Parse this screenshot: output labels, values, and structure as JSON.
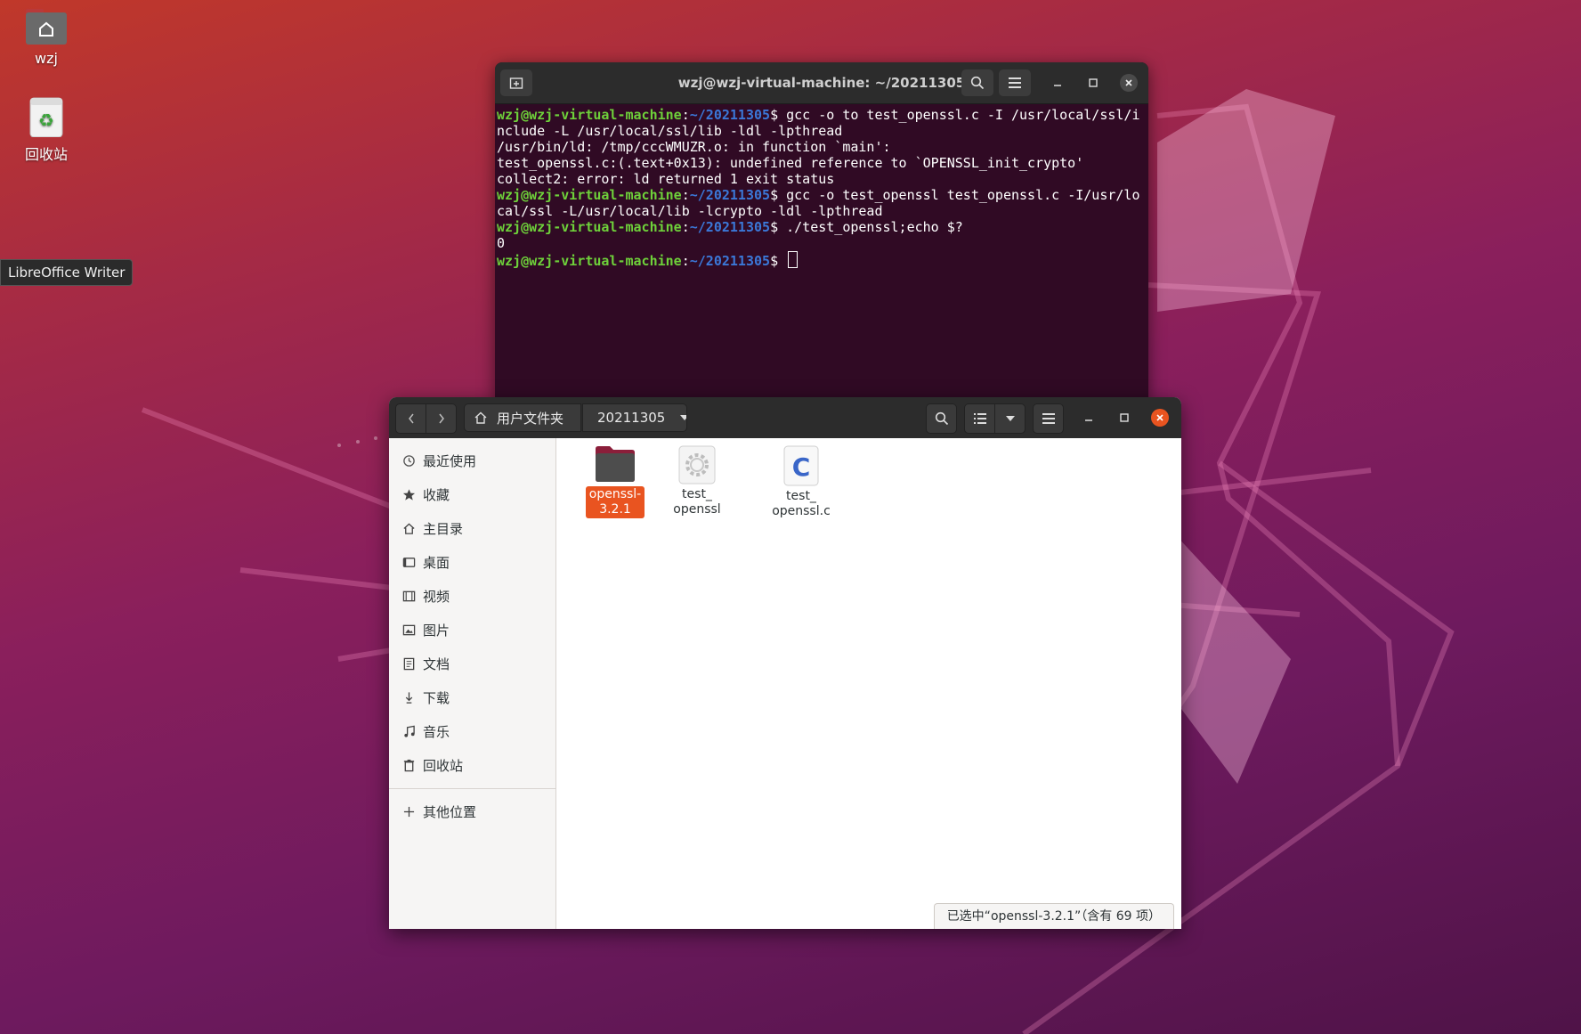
{
  "desktop": {
    "home_icon_label": "wzj",
    "trash_icon_label": "回收站",
    "tooltip": "LibreOffice Writer"
  },
  "terminal": {
    "title": "wzj@wzj-virtual-machine: ~/20211305",
    "prompt_user": "wzj@wzj-virtual-machine",
    "prompt_path": "~/20211305",
    "lines": [
      {
        "type": "cmd",
        "text": "gcc -o to test_openssl.c -I /usr/local/ssl/include -L /usr/local/ssl/lib -ldl -lpthread"
      },
      {
        "type": "out",
        "text": "/usr/bin/ld: /tmp/cccWMUZR.o: in function `main':"
      },
      {
        "type": "out",
        "text": "test_openssl.c:(.text+0x13): undefined reference to `OPENSSL_init_crypto'"
      },
      {
        "type": "out",
        "text": "collect2: error: ld returned 1 exit status"
      },
      {
        "type": "cmd",
        "text": "gcc -o test_openssl test_openssl.c -I/usr/local/ssl -L/usr/local/lib -lcrypto -ldl -lpthread"
      },
      {
        "type": "cmd",
        "text": "./test_openssl;echo $?"
      },
      {
        "type": "out",
        "text": "0"
      },
      {
        "type": "cmd",
        "text": ""
      }
    ]
  },
  "files": {
    "breadcrumb_home": "用户文件夹",
    "breadcrumb_current": "20211305",
    "sidebar": [
      {
        "label": "最近使用",
        "icon": "clock-icon"
      },
      {
        "label": "收藏",
        "icon": "star-icon"
      },
      {
        "label": "主目录",
        "icon": "home-icon"
      },
      {
        "label": "桌面",
        "icon": "desktop-icon"
      },
      {
        "label": "视频",
        "icon": "video-icon"
      },
      {
        "label": "图片",
        "icon": "image-icon"
      },
      {
        "label": "文档",
        "icon": "document-icon"
      },
      {
        "label": "下载",
        "icon": "download-icon"
      },
      {
        "label": "音乐",
        "icon": "music-icon"
      },
      {
        "label": "回收站",
        "icon": "trash-icon"
      }
    ],
    "other_locations": "其他位置",
    "items": [
      {
        "name": "openssl-3.2.1",
        "line1": "openssl-",
        "line2": "3.2.1",
        "type": "folder",
        "selected": true
      },
      {
        "name": "test_openssl",
        "line1": "test_",
        "line2": "openssl",
        "type": "executable",
        "selected": false
      },
      {
        "name": "test_openssl.c",
        "line1": "test_",
        "line2": "openssl.c",
        "type": "c-source",
        "selected": false
      }
    ],
    "status": "已选中“openssl-3.2.1”（含有 69 项）"
  },
  "colors": {
    "accent": "#e95420",
    "terminal_bg": "#300a24",
    "prompt_user": "#6ed13a",
    "prompt_path": "#3b78d8"
  }
}
